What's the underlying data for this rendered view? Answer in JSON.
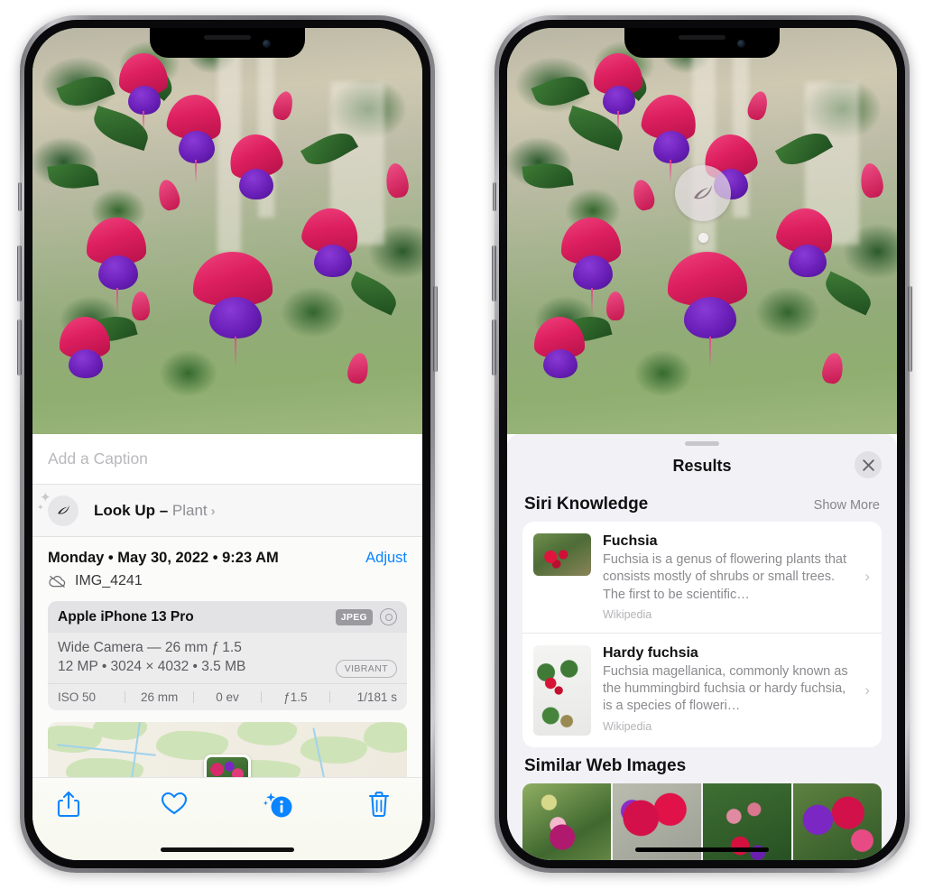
{
  "left_phone": {
    "caption": {
      "placeholder": "Add a Caption"
    },
    "lookup": {
      "icon": "leaf-icon",
      "label": "Look Up –",
      "subject": "Plant",
      "chevron": "›"
    },
    "metadata": {
      "date": "Monday • May 30, 2022 • 9:23 AM",
      "adjust_label": "Adjust",
      "cloud_icon": "cloud-slash-icon",
      "filename": "IMG_4241"
    },
    "exif": {
      "device": "Apple iPhone 13 Pro",
      "format_badge": "JPEG",
      "aperture_icon": "aperture-icon",
      "lens": "Wide Camera — 26 mm ƒ 1.5",
      "size_line": "12 MP • 3024 × 4032 • 3.5 MB",
      "style_badge": "VIBRANT",
      "stats": [
        "ISO 50",
        "26 mm",
        "0 ev",
        "ƒ1.5",
        "1/181 s"
      ]
    },
    "toolbar": [
      {
        "name": "share-button",
        "icon": "share-icon"
      },
      {
        "name": "favorite-button",
        "icon": "heart-icon"
      },
      {
        "name": "info-button",
        "icon": "info-sparkle-icon"
      },
      {
        "name": "delete-button",
        "icon": "trash-icon"
      }
    ]
  },
  "right_phone": {
    "visual_lookup_badge": {
      "icon": "leaf-icon"
    },
    "sheet": {
      "title": "Results",
      "close_icon": "close-icon",
      "siri": {
        "heading": "Siri Knowledge",
        "show_more": "Show More",
        "cards": [
          {
            "title": "Fuchsia",
            "description": "Fuchsia is a genus of flowering plants that consists mostly of shrubs or small trees. The first to be scientific…",
            "source": "Wikipedia",
            "chevron": "›"
          },
          {
            "title": "Hardy fuchsia",
            "description": "Fuchsia magellanica, commonly known as the hummingbird fuchsia or hardy fuchsia, is a species of floweri…",
            "source": "Wikipedia",
            "chevron": "›"
          }
        ]
      },
      "similar": {
        "heading": "Similar Web Images",
        "thumbnails": [
          "fuchsia-thumb-1",
          "fuchsia-thumb-2",
          "fuchsia-thumb-3",
          "fuchsia-thumb-4"
        ]
      }
    }
  },
  "colors": {
    "accent_blue": "#0a84ff",
    "sheet_bg": "#f2f1f6",
    "card_bg": "#ffffff",
    "secondary_text": "#8e8e93"
  }
}
